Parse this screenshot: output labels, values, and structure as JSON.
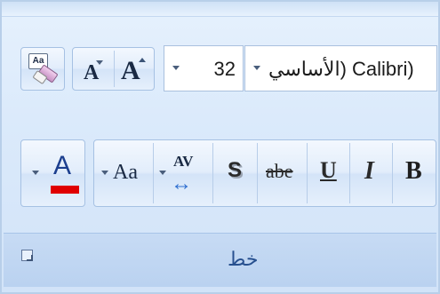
{
  "font_group": {
    "title": "خط",
    "font_name": "الأساسي) Calibri)",
    "font_size": "32",
    "accent_color": "#e00000",
    "buttons": {
      "bold": "B",
      "italic": "I",
      "underline": "U",
      "strikethrough": "abe",
      "shadow": "S",
      "char_spacing": "AV",
      "change_case": "Aa",
      "font_color": "A",
      "grow_font": "A",
      "shrink_font": "A",
      "clear_format": "Aa"
    },
    "icons": {
      "dialog_launcher": "dialog-launcher-icon",
      "eraser": "eraser-icon",
      "dropdown": "dropdown-arrow-icon"
    }
  }
}
